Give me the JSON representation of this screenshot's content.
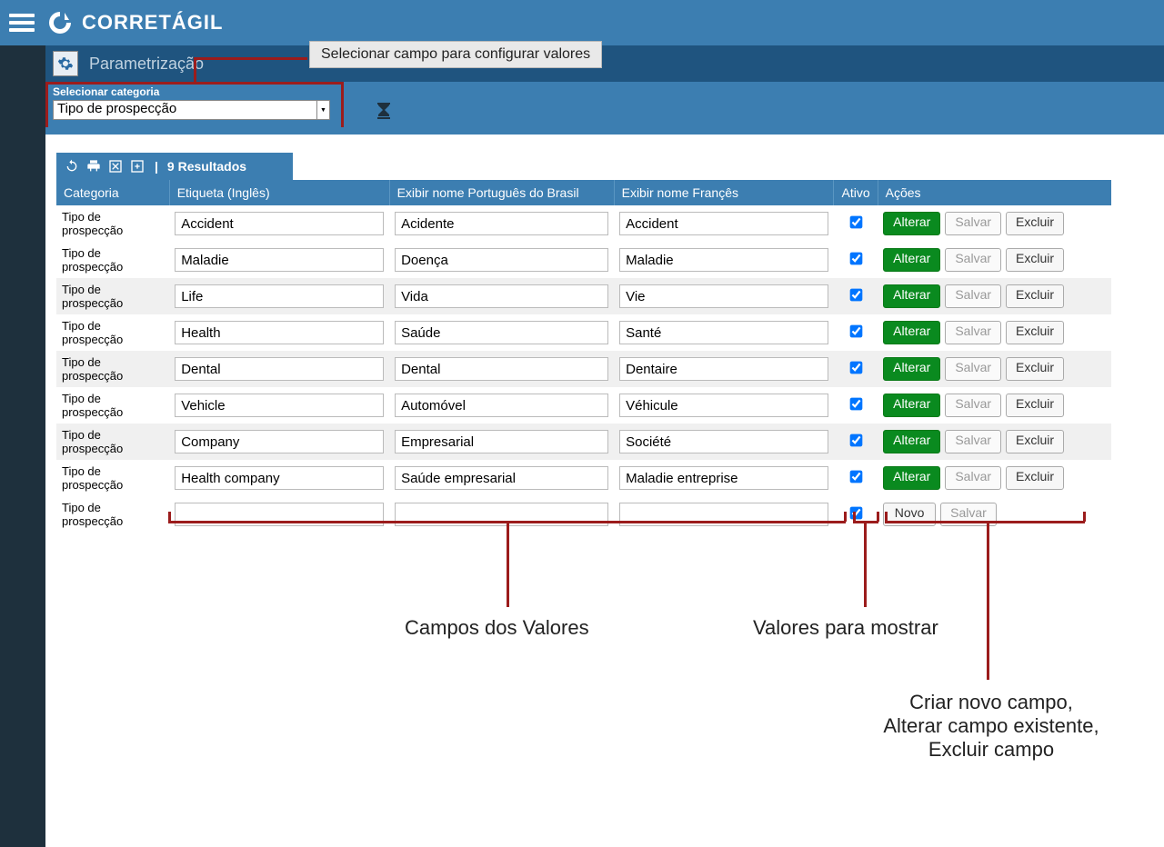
{
  "header": {
    "appName": "CORRETÁGIL"
  },
  "tab": {
    "label": "Parametrização"
  },
  "tooltip": {
    "text": "Selecionar campo para configurar valores"
  },
  "filter": {
    "label": "Selecionar categoria",
    "value": "Tipo de prospecção"
  },
  "toolbar": {
    "resultsLabel": "9 Resultados"
  },
  "columns": {
    "categoria": "Categoria",
    "etiqueta": "Etiqueta (Inglês)",
    "nomePt": "Exibir nome Português do Brasil",
    "nomeFr": "Exibir nome Françês",
    "ativo": "Ativo",
    "acoes": "Ações"
  },
  "buttons": {
    "alterar": "Alterar",
    "salvar": "Salvar",
    "excluir": "Excluir",
    "novo": "Novo"
  },
  "rows": [
    {
      "cat": "Tipo de prospecção",
      "en": "Accident",
      "pt": "Acidente",
      "fr": "Accident",
      "active": true
    },
    {
      "cat": "Tipo de prospecção",
      "en": "Maladie",
      "pt": "Doença",
      "fr": "Maladie",
      "active": true
    },
    {
      "cat": "Tipo de prospecção",
      "en": "Life",
      "pt": "Vida",
      "fr": "Vie",
      "active": true
    },
    {
      "cat": "Tipo de prospecção",
      "en": "Health",
      "pt": "Saúde",
      "fr": "Santé",
      "active": true
    },
    {
      "cat": "Tipo de prospecção",
      "en": "Dental",
      "pt": "Dental",
      "fr": "Dentaire",
      "active": true
    },
    {
      "cat": "Tipo de prospecção",
      "en": "Vehicle",
      "pt": "Automóvel",
      "fr": "Véhicule",
      "active": true
    },
    {
      "cat": "Tipo de prospecção",
      "en": "Company",
      "pt": "Empresarial",
      "fr": "Société",
      "active": true
    },
    {
      "cat": "Tipo de prospecção",
      "en": "Health company",
      "pt": "Saúde empresarial",
      "fr": "Maladie entreprise",
      "active": true
    }
  ],
  "newRow": {
    "cat": "Tipo de prospecção",
    "active": true
  },
  "annotations": {
    "camposValores": "Campos dos Valores",
    "valoresMostrar": "Valores para mostrar",
    "acoesDesc": "Criar novo campo,\nAlterar campo existente,\nExcluir campo"
  }
}
